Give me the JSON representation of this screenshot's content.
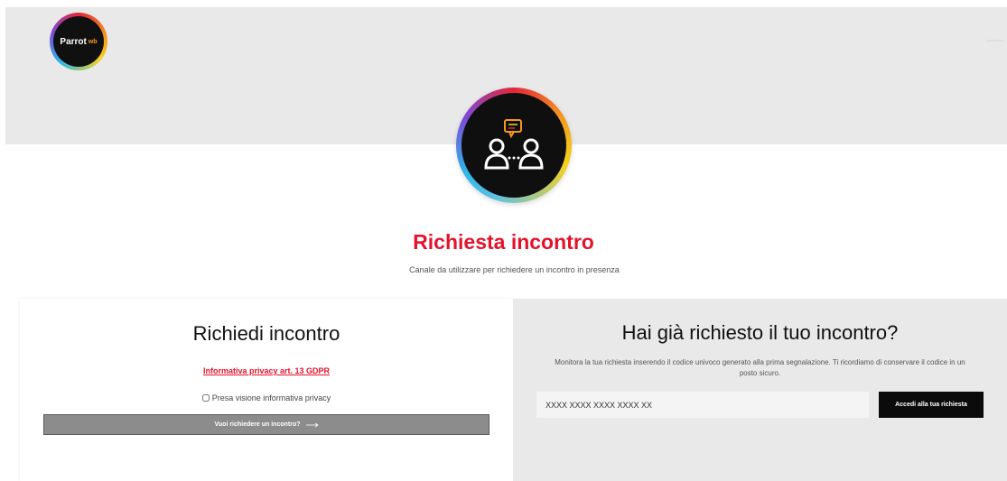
{
  "header": {
    "logo": {
      "text": "Parrot",
      "accent": "wb",
      "icon": "parrot-logo"
    }
  },
  "hero": {
    "icon": "meeting-people-chat-icon"
  },
  "page": {
    "title": "Richiesta incontro",
    "subtitle": "Canale da utilizzare per richiedere un incontro in presenza"
  },
  "request_panel": {
    "title": "Richiedi incontro",
    "privacy_link": "Informativa privacy art. 13 GDPR",
    "consent_label": "Presa visione informativa privacy",
    "consent_checked": false,
    "button_label": "Vuoi richiedere un incontro?",
    "button_icon": "arrow-right-icon"
  },
  "track_panel": {
    "title": "Hai già richiesto il tuo incontro?",
    "description": "Monitora la tua richiesta inserendo il codice univoco generato alla prima segnalazione. Ti ricordiamo di conservare il codice in un posto sicuro.",
    "code_placeholder": "XXXX XXXX XXXX XXXX XX",
    "code_value": "",
    "button_label": "Accedi alla tua richiesta"
  },
  "colors": {
    "accent_red": "#e3132c",
    "header_bg": "#e9e9e9",
    "button_gray": "#8c8c8c",
    "button_black": "#0b0b0b"
  }
}
